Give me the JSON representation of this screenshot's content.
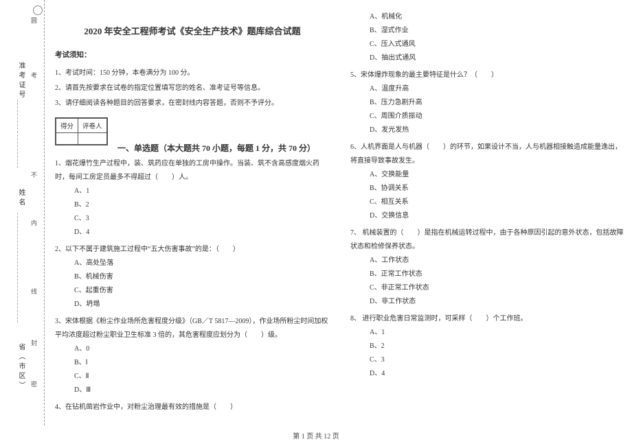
{
  "binding": {
    "circle_top_hint": "圆",
    "markers": [
      "考",
      "不",
      "内",
      "线",
      "封",
      "密"
    ],
    "labels": [
      "准考证号",
      "姓名",
      "省（市区）"
    ]
  },
  "header": {
    "title": "2020 年安全工程师考试《安全生产技术》题库综合试题"
  },
  "notice": {
    "heading": "考试须知：",
    "items": [
      "1、考试时间：150 分钟，本卷满分为 100 分。",
      "2、请首先按要求在试卷的指定位置填写您的姓名、准考证号等信息。",
      "3、请仔细阅读各种题目的回答要求，在密封线内容答题，否则不予评分。"
    ]
  },
  "scorebox": {
    "c1": "得分",
    "c2": "评卷人"
  },
  "section1": {
    "title": "一、单选题（本大题共 70 小题，每题 1 分，共 70 分）"
  },
  "left_questions": {
    "q1": {
      "stem": "1、烟花爆竹生产过程中，装、筑药应在单独的工房中操作。当装、筑不含高感度烟火药时，每间工房定员最多不得超过（　　）人。",
      "A": "A、1",
      "B": "B、2",
      "C": "C、3",
      "D": "D、4"
    },
    "q2": {
      "stem": "2、以下不属于建筑施工过程中“五大伤害事故”的是：（　　）",
      "A": "A、高处坠落",
      "B": "B、机械伤害",
      "C": "C、起重伤害",
      "D": "D、坍塌"
    },
    "q3": {
      "stem": "3、宋体根据《粉尘作业场所危害程度分级》（GB／T 5817—2009），作业场所粉尘时间加权平均浓度超过粉尘职业卫生标准 3 倍的，其危害程度应划分为（　　）级。",
      "A": "A、0",
      "B": "B、Ⅰ",
      "C": "C、Ⅱ",
      "D": "D、Ⅲ"
    },
    "q4": {
      "stem": "4、在钻机凿岩作业中，对粉尘治理最有效的措施是（　　）"
    }
  },
  "right_questions": {
    "q4opts": {
      "A": "A、机械化",
      "B": "B、湿式作业",
      "C": "C、压入式通风",
      "D": "D、抽出式通风"
    },
    "q5": {
      "stem": "5、宋体爆炸现象的最主要特征是什么？（　　）",
      "A": "A、温度升高",
      "B": "B、压力急剧升高",
      "C": "C、周围介质振动",
      "D": "D、发光发热"
    },
    "q6": {
      "stem": "6、人机界面是人与机器（　　）的环节，如果设计不当，人与机器相接触造成能量逸出，将直接导致事故发生。",
      "A": "A、交换能量",
      "B": "B、协调关系",
      "C": "C、相互关系",
      "D": "D、交换信息"
    },
    "q7": {
      "stem": "7、 机械装置的（　　）是指在机械运转过程中，由于各种原因引起的意外状态，包括故障状态和检修保养状态。",
      "A": "A、工作状态",
      "B": "B、正常工作状态",
      "C": "C、非正常工作状态",
      "D": "D、非工作状态"
    },
    "q8": {
      "stem": "8、 进行职业危害日常监测时，可采样（　　）个工作班。",
      "A": "A、1",
      "B": "B、2",
      "C": "C、3",
      "D": "D、4"
    }
  },
  "footer": {
    "text": "第 1 页 共 12 页"
  }
}
